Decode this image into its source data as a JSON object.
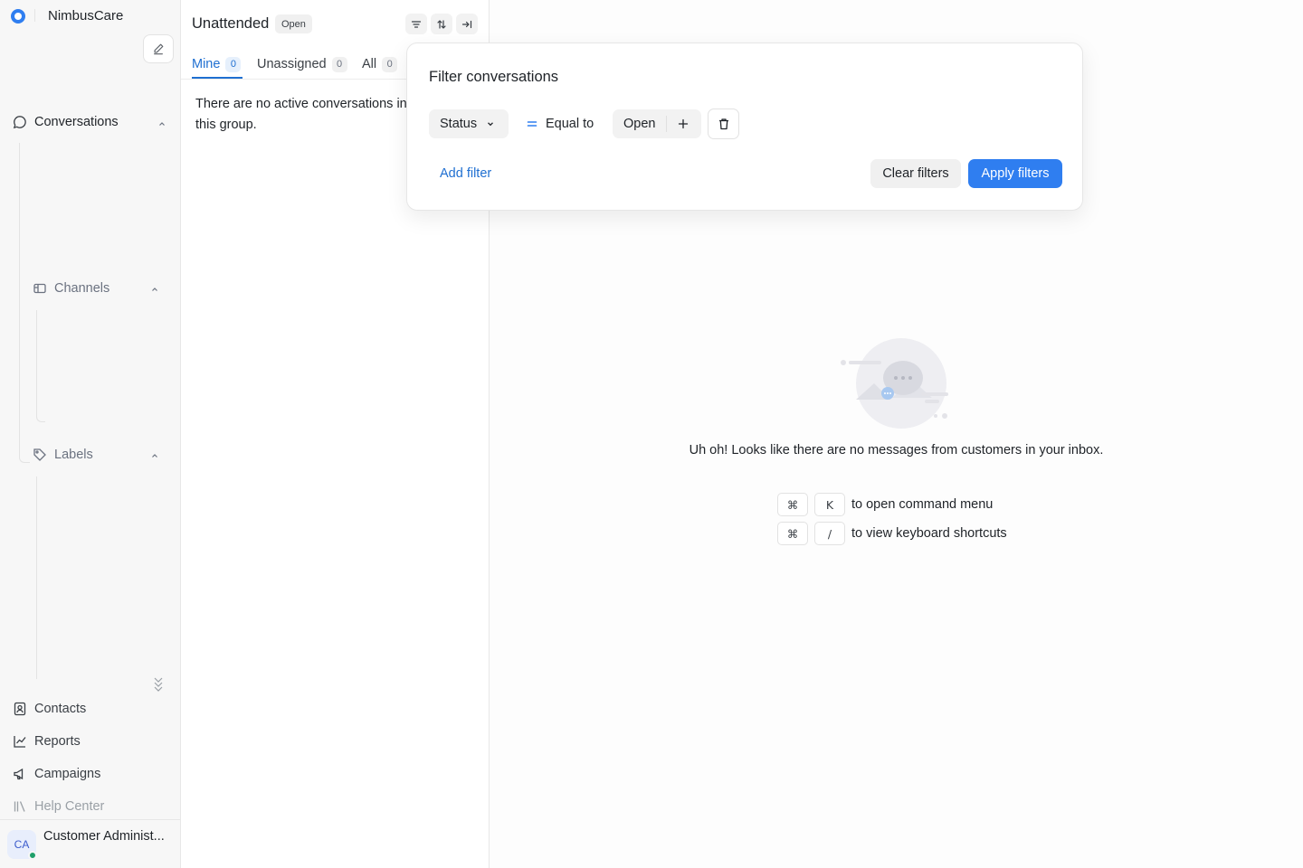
{
  "brand": {
    "name": "NimbusCare",
    "logo_color": "#2f7ef0"
  },
  "sidebar": {
    "conversations_label": "Conversations",
    "channels_label": "Channels",
    "labels_label": "Labels",
    "bottom_items": [
      {
        "label": "Contacts",
        "icon": "contacts-icon"
      },
      {
        "label": "Reports",
        "icon": "chart-line-icon"
      },
      {
        "label": "Campaigns",
        "icon": "megaphone-icon"
      },
      {
        "label": "Help Center",
        "icon": "library-icon"
      }
    ],
    "user": {
      "initials": "CA",
      "name": "Customer Administ...",
      "presence_color": "#20a06a"
    }
  },
  "list": {
    "title": "Unattended",
    "status_badge": "Open",
    "tabs": [
      {
        "label": "Mine",
        "count": "0",
        "active": true
      },
      {
        "label": "Unassigned",
        "count": "0",
        "active": false
      },
      {
        "label": "All",
        "count": "0",
        "active": false
      }
    ],
    "empty_text": "There are no active conversations in this group."
  },
  "filter_modal": {
    "title": "Filter conversations",
    "attribute": "Status",
    "operator": "Equal to",
    "value": "Open",
    "add_filter": "Add filter",
    "clear_filters": "Clear filters",
    "apply_filters": "Apply filters"
  },
  "main": {
    "empty_message": "Uh oh! Looks like there are no messages from customers in your inbox.",
    "shortcuts": [
      {
        "key1": "⌘",
        "key2": "K",
        "text": "to open command menu"
      },
      {
        "key1": "⌘",
        "key2": "/",
        "text": "to view keyboard shortcuts"
      }
    ]
  },
  "colors": {
    "accent": "#2f7ef0",
    "link": "#1f6fd1"
  }
}
